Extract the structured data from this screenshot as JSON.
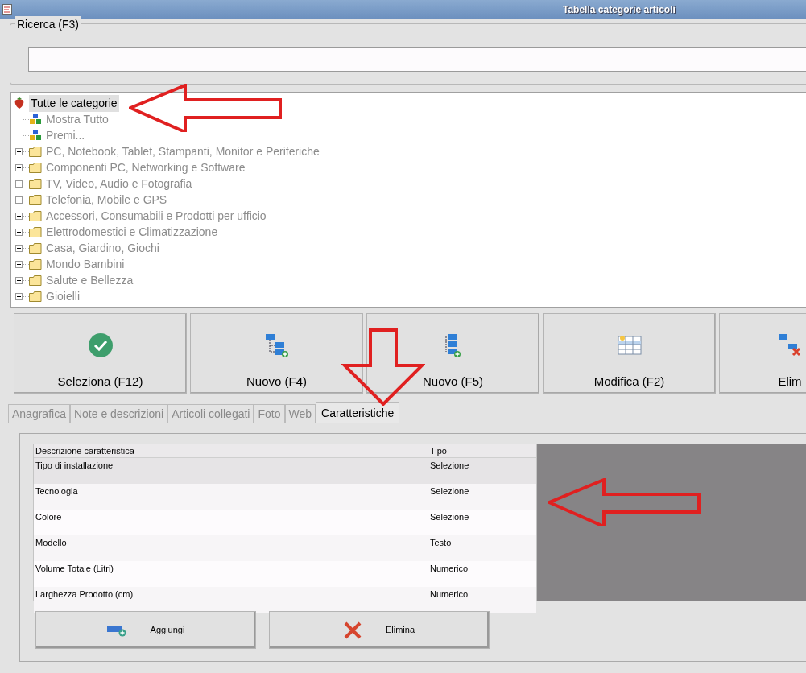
{
  "window": {
    "title": "Tabella categorie articoli"
  },
  "search": {
    "label": "Ricerca (F3)"
  },
  "tree": {
    "root": {
      "label": "Tutte le categorie",
      "selected": true,
      "children": [
        {
          "label": "Mostra Tutto",
          "kind": "filter"
        },
        {
          "label": "Premi...",
          "kind": "filter"
        },
        {
          "label": "PC, Notebook, Tablet, Stampanti, Monitor e Periferiche",
          "kind": "folder"
        },
        {
          "label": "Componenti PC, Networking e Software",
          "kind": "folder"
        },
        {
          "label": "TV, Video, Audio e Fotografia",
          "kind": "folder"
        },
        {
          "label": "Telefonia, Mobile e GPS",
          "kind": "folder"
        },
        {
          "label": "Accessori, Consumabili e Prodotti per ufficio",
          "kind": "folder"
        },
        {
          "label": "Elettrodomestici e Climatizzazione",
          "kind": "folder"
        },
        {
          "label": "Casa, Giardino, Giochi",
          "kind": "folder"
        },
        {
          "label": "Mondo Bambini",
          "kind": "folder"
        },
        {
          "label": "Salute e Bellezza",
          "kind": "folder"
        },
        {
          "label": "Gioielli",
          "kind": "folder"
        }
      ]
    }
  },
  "toolbar": [
    {
      "label": "Seleziona (F12)",
      "kind": "select"
    },
    {
      "label": "Nuovo (F4)",
      "kind": "new-sibling"
    },
    {
      "label": "Nuovo (F5)",
      "kind": "new-child"
    },
    {
      "label": "Modifica (F2)",
      "kind": "edit"
    },
    {
      "label": "Elim",
      "kind": "delete"
    }
  ],
  "tabs": [
    {
      "label": "Anagrafica",
      "selected": false
    },
    {
      "label": "Note e descrizioni",
      "selected": false
    },
    {
      "label": "Articoli collegati",
      "selected": false
    },
    {
      "label": "Foto",
      "selected": false
    },
    {
      "label": "Web",
      "selected": false
    },
    {
      "label": "Caratteristiche",
      "selected": true
    }
  ],
  "table": {
    "columns": [
      "Descrizione caratteristica",
      "Tipo"
    ],
    "rows": [
      {
        "cells": [
          "Tipo di installazione",
          "Selezione"
        ],
        "selected": true
      },
      {
        "cells": [
          "Tecnologia",
          "Selezione"
        ],
        "selected": false
      },
      {
        "cells": [
          "Colore",
          "Selezione"
        ],
        "selected": false
      },
      {
        "cells": [
          "Modello",
          "Testo"
        ],
        "selected": false
      },
      {
        "cells": [
          "Volume Totale (Litri)",
          "Numerico"
        ],
        "selected": false
      },
      {
        "cells": [
          "Larghezza Prodotto (cm)",
          "Numerico"
        ],
        "selected": false
      }
    ]
  },
  "actions": [
    {
      "label": "Aggiungi",
      "kind": "add"
    },
    {
      "label": "Elimina",
      "kind": "delete"
    }
  ]
}
